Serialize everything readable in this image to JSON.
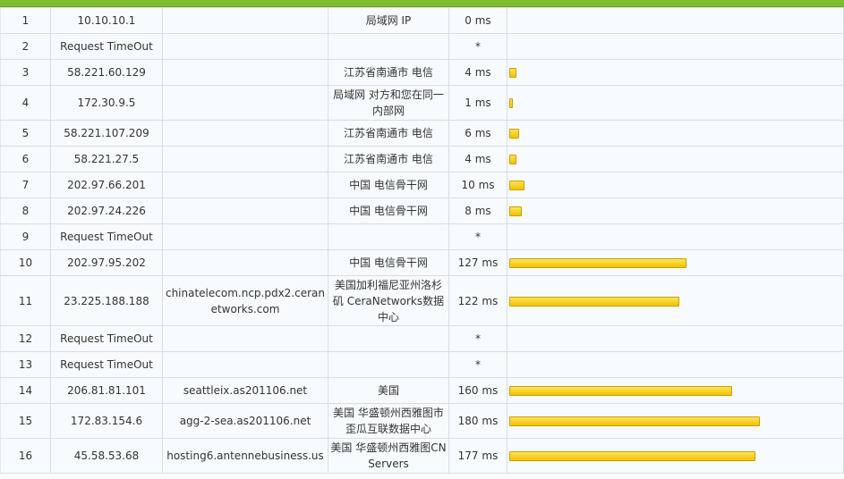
{
  "colors": {
    "header_bar": "#7fba2f",
    "bar_fill": "#f2c200",
    "cell_bg": "#f7fbfd"
  },
  "max_ms_scale": 240,
  "rows": [
    {
      "hop": "1",
      "ip": "10.10.10.1",
      "host": "",
      "location": "局域网 IP",
      "time": "0 ms",
      "ms": 0
    },
    {
      "hop": "2",
      "ip": "Request TimeOut",
      "host": "",
      "location": "",
      "time": "*",
      "ms": null
    },
    {
      "hop": "3",
      "ip": "58.221.60.129",
      "host": "",
      "location": "江苏省南通市 电信",
      "time": "4 ms",
      "ms": 4
    },
    {
      "hop": "4",
      "ip": "172.30.9.5",
      "host": "",
      "location": "局域网 对方和您在同一内部网",
      "time": "1 ms",
      "ms": 1
    },
    {
      "hop": "5",
      "ip": "58.221.107.209",
      "host": "",
      "location": "江苏省南通市 电信",
      "time": "6 ms",
      "ms": 6
    },
    {
      "hop": "6",
      "ip": "58.221.27.5",
      "host": "",
      "location": "江苏省南通市 电信",
      "time": "4 ms",
      "ms": 4
    },
    {
      "hop": "7",
      "ip": "202.97.66.201",
      "host": "",
      "location": "中国 电信骨干网",
      "time": "10 ms",
      "ms": 10
    },
    {
      "hop": "8",
      "ip": "202.97.24.226",
      "host": "",
      "location": "中国 电信骨干网",
      "time": "8 ms",
      "ms": 8
    },
    {
      "hop": "9",
      "ip": "Request TimeOut",
      "host": "",
      "location": "",
      "time": "*",
      "ms": null
    },
    {
      "hop": "10",
      "ip": "202.97.95.202",
      "host": "",
      "location": "中国 电信骨干网",
      "time": "127 ms",
      "ms": 127
    },
    {
      "hop": "11",
      "ip": "23.225.188.188",
      "host": "chinatelecom.ncp.pdx2.ceranetworks.com",
      "location": "美国加利福尼亚州洛杉矶 CeraNetworks数据中心",
      "time": "122 ms",
      "ms": 122
    },
    {
      "hop": "12",
      "ip": "Request TimeOut",
      "host": "",
      "location": "",
      "time": "*",
      "ms": null
    },
    {
      "hop": "13",
      "ip": "Request TimeOut",
      "host": "",
      "location": "",
      "time": "*",
      "ms": null
    },
    {
      "hop": "14",
      "ip": "206.81.81.101",
      "host": "seattleix.as201106.net",
      "location": "美国",
      "time": "160 ms",
      "ms": 160
    },
    {
      "hop": "15",
      "ip": "172.83.154.6",
      "host": "agg-2-sea.as201106.net",
      "location": "美国 华盛顿州西雅图市歪瓜互联数据中心",
      "time": "180 ms",
      "ms": 180
    },
    {
      "hop": "16",
      "ip": "45.58.53.68",
      "host": "hosting6.antennebusiness.us",
      "location": "美国 华盛顿州西雅图CN Servers",
      "time": "177 ms",
      "ms": 177
    }
  ]
}
